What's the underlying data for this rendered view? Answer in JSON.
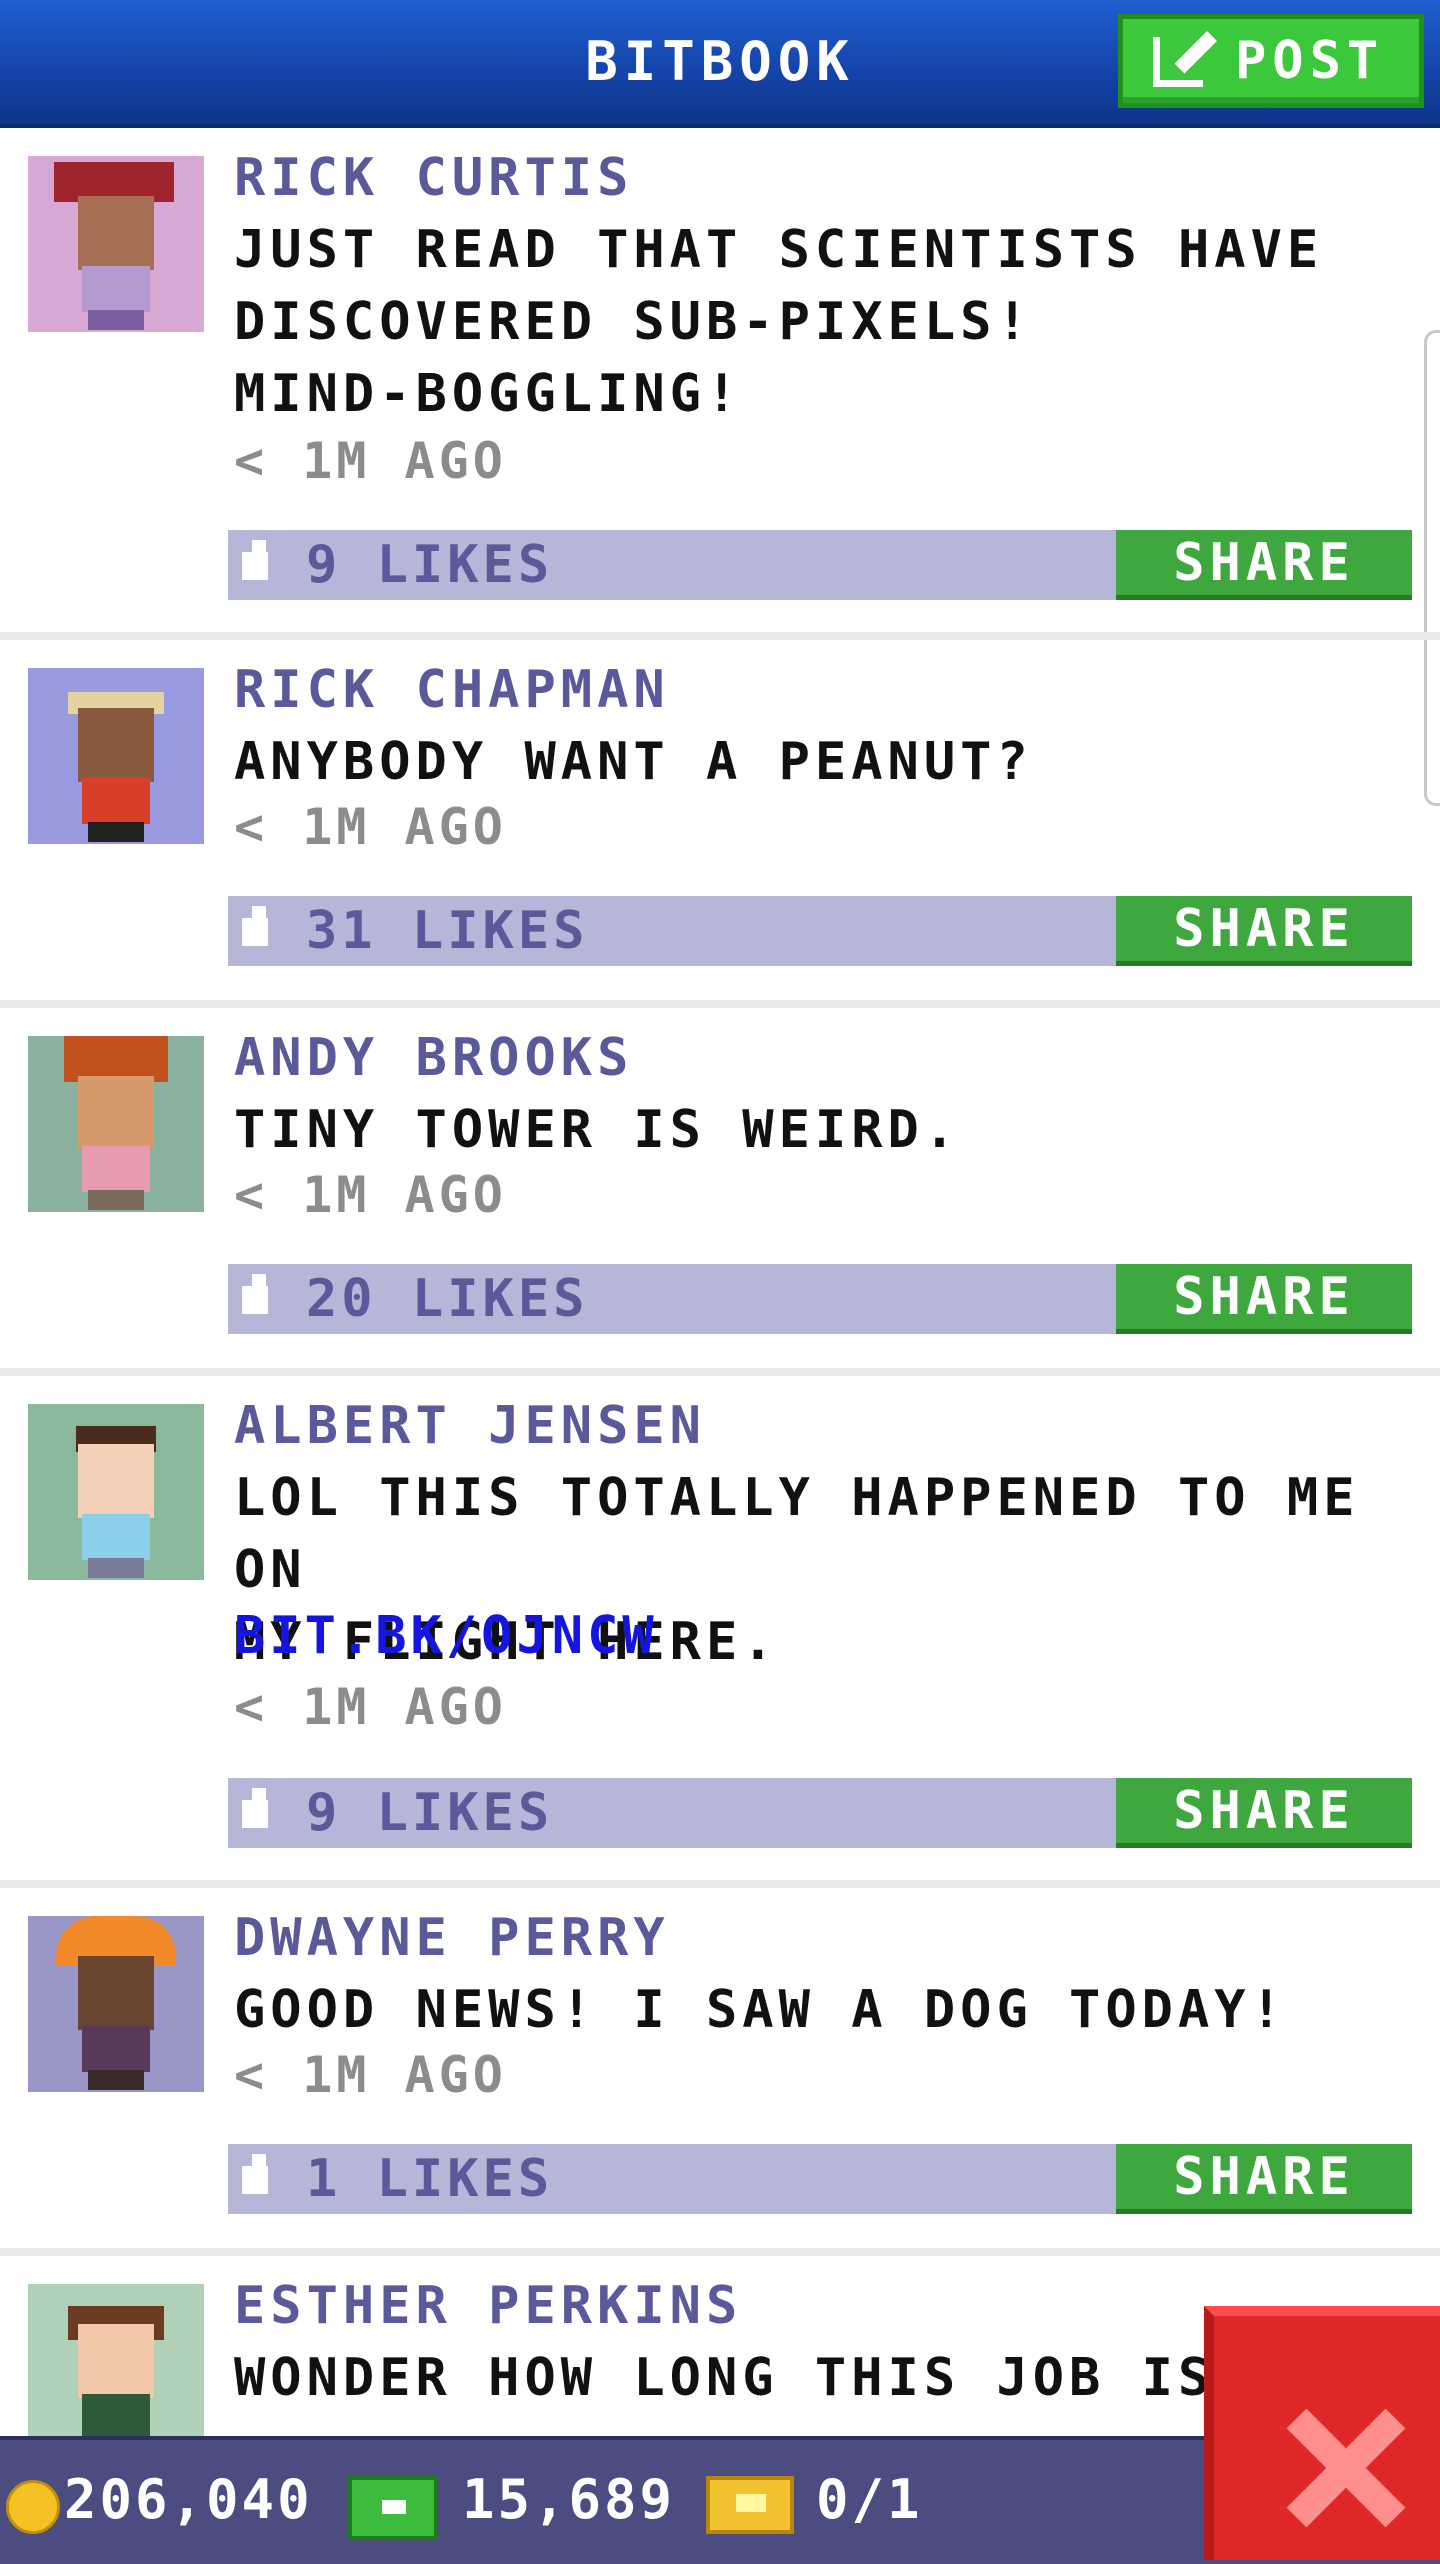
{
  "header": {
    "title": "BITBOOK",
    "post_label": "POST"
  },
  "posts": [
    {
      "name": "RICK CURTIS",
      "text": "JUST READ THAT SCIENTISTS HAVE\nDISCOVERED SUB-PIXELS!\nMIND-BOGGLING!",
      "link": "",
      "time": "< 1M AGO",
      "likes": "9 LIKES",
      "share": "SHARE"
    },
    {
      "name": "RICK CHAPMAN",
      "text": "ANYBODY WANT A PEANUT?",
      "link": "",
      "time": "< 1M AGO",
      "likes": "31 LIKES",
      "share": "SHARE"
    },
    {
      "name": "ANDY BROOKS",
      "text": "TINY TOWER IS WEIRD.",
      "link": "",
      "time": "< 1M AGO",
      "likes": "20 LIKES",
      "share": "SHARE"
    },
    {
      "name": "ALBERT JENSEN",
      "text": "LOL THIS TOTALLY HAPPENED TO ME ON\nMY FLIGHT HERE.",
      "link": "BIT.BK/OJNCW",
      "time": "< 1M AGO",
      "likes": "9 LIKES",
      "share": "SHARE"
    },
    {
      "name": "DWAYNE PERRY",
      "text": "GOOD NEWS! I SAW A DOG TODAY!",
      "link": "",
      "time": "< 1M AGO",
      "likes": "1 LIKES",
      "share": "SHARE"
    },
    {
      "name": "ESTHER PERKINS",
      "text": "WONDER HOW LONG THIS JOB IS",
      "link": "",
      "time": "",
      "likes": "",
      "share": ""
    }
  ],
  "status_bar": {
    "coins": "206,040",
    "bux": "15,689",
    "tickets": "0/1"
  },
  "colors": {
    "header_blue": "#1443a8",
    "post_green": "#3cc83c",
    "share_green": "#3ea83e",
    "like_bar": "#b6b6d8",
    "name_purple": "#5a5a9a",
    "link_blue": "#1515e0",
    "close_red": "#e12828"
  }
}
